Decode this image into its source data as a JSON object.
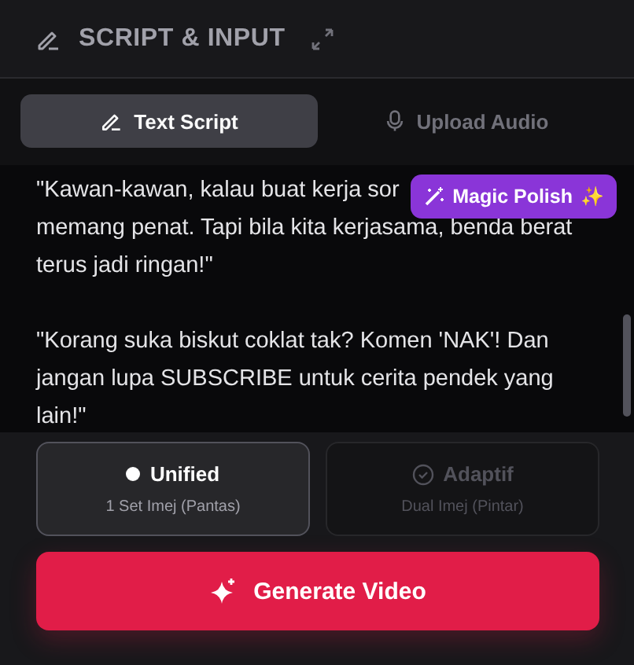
{
  "header": {
    "title": "SCRIPT & INPUT"
  },
  "tabs": [
    {
      "label": "Text Script",
      "selected": true
    },
    {
      "label": "Upload Audio",
      "selected": false
    }
  ],
  "script": {
    "paragraphs": [
      {
        "lines": [
          "\"Kawan-kawan, kalau buat kerja sor",
          "memang penat. Tapi bila kita kerjasama, benda berat",
          "terus jadi ringan!\""
        ]
      },
      {
        "lines": [
          "\"Korang suka biskut coklat tak? Komen 'NAK'! Dan",
          "jangan lupa SUBSCRIBE untuk cerita pendek yang",
          "lain!\""
        ]
      }
    ]
  },
  "magic_button": {
    "label": "Magic Polish",
    "trailing": "✨"
  },
  "modes": [
    {
      "title": "Unified",
      "subtitle": "1 Set Imej (Pantas)",
      "selected": true
    },
    {
      "title": "Adaptif",
      "subtitle": "Dual Imej (Pintar)",
      "selected": false
    }
  ],
  "generate_button": {
    "label": "Generate Video"
  }
}
